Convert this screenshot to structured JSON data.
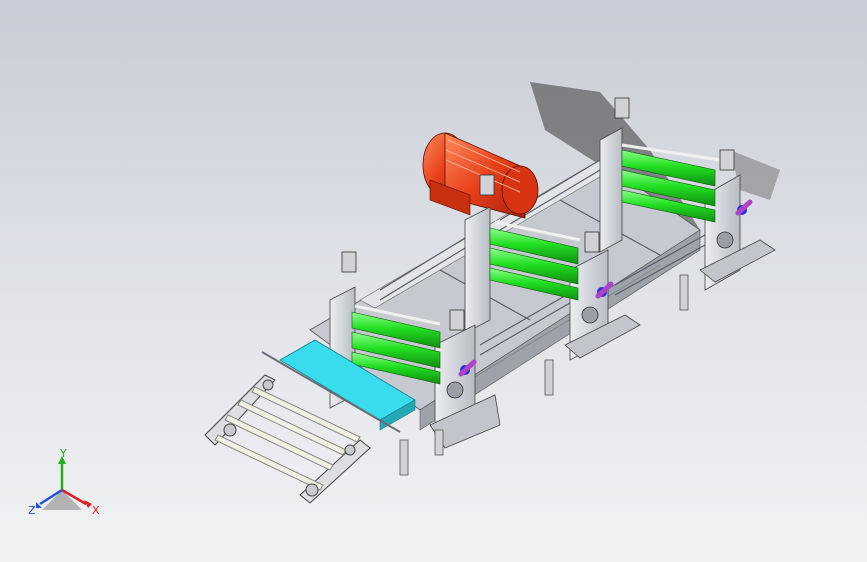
{
  "viewport": {
    "background_top": "#c8ccd6",
    "background_bottom": "#f2f2f4"
  },
  "model": {
    "roller_color": "#22e022",
    "belt_color": "#38dcec",
    "motor_color": "#e8401a",
    "frame_color": "#d6d8dc",
    "handle_color": "#b042c8"
  },
  "triad": {
    "x_label": "X",
    "y_label": "Y",
    "z_label": "Z",
    "x_color": "#e02020",
    "y_color": "#20b020",
    "z_color": "#2050e0"
  }
}
